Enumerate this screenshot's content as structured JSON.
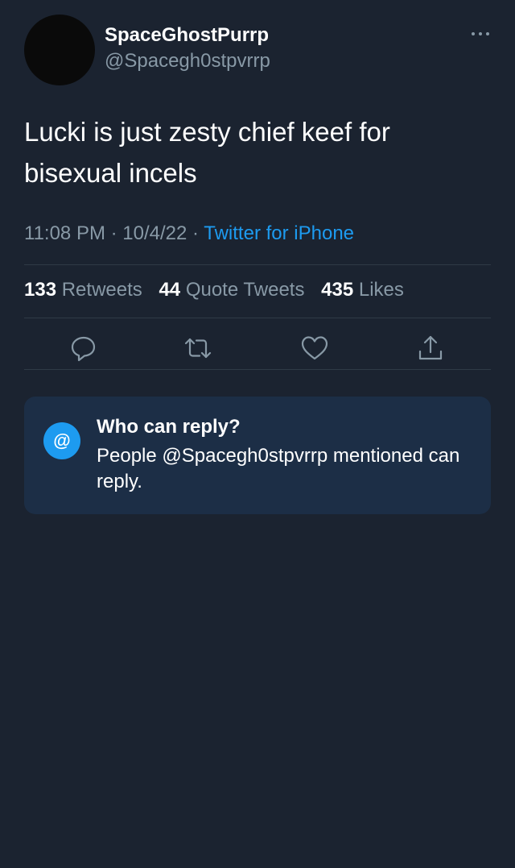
{
  "author": {
    "display_name": "SpaceGhostPurrp",
    "handle": "@Spacegh0stpvrrp"
  },
  "more_icon": "more-horizontal-icon",
  "tweet": {
    "text": "Lucki is just zesty chief keef for bisexual incels",
    "time": "11:08 PM",
    "separator": " · ",
    "date": "10/4/22",
    "source": "Twitter for iPhone"
  },
  "stats": {
    "retweets_count": "133",
    "retweets_label": "Retweets",
    "quotes_count": "44",
    "quotes_label": "Quote Tweets",
    "likes_count": "435",
    "likes_label": "Likes"
  },
  "actions": [
    "reply-icon",
    "retweet-icon",
    "like-icon",
    "share-icon"
  ],
  "reply_settings": {
    "icon_glyph": "@",
    "title": "Who can reply?",
    "body": "People @Spacegh0stpvrrp mentioned can reply."
  },
  "colors": {
    "background": "#1b2330",
    "accent": "#1d9bf0",
    "secondary_text": "#8899a6",
    "card": "#1c2e46"
  }
}
